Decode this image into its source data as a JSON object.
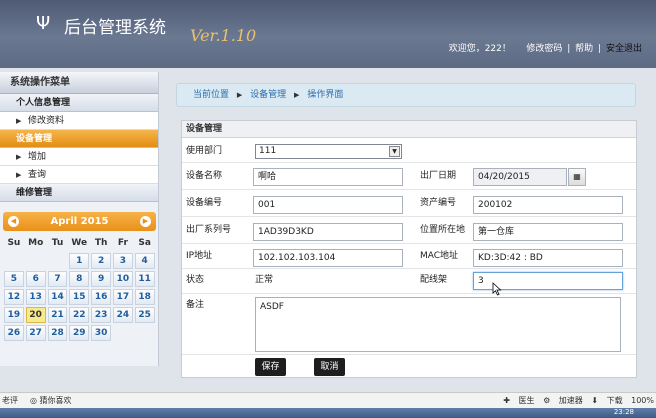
{
  "header": {
    "logo_glyph": "Ψ",
    "title": "后台管理系统",
    "version": "Ver.1.10",
    "welcome": "欢迎您，222！",
    "change_password": "修改密码",
    "help": "帮助",
    "logout": "安全退出"
  },
  "sidebar": {
    "title": "系统操作菜单",
    "groups": [
      {
        "label": "个人信息管理",
        "items": [
          "修改资料"
        ]
      },
      {
        "label": "设备管理",
        "items": [
          "增加",
          "查询"
        ]
      },
      {
        "label": "维修管理",
        "items": []
      }
    ]
  },
  "calendar": {
    "month_label": "April 2015",
    "weekdays": [
      "Su",
      "Mo",
      "Tu",
      "We",
      "Th",
      "Fr",
      "Sa"
    ],
    "today": "20",
    "weeks": [
      [
        "",
        "",
        "",
        "1",
        "2",
        "3",
        "4"
      ],
      [
        "5",
        "6",
        "7",
        "8",
        "9",
        "10",
        "11"
      ],
      [
        "12",
        "13",
        "14",
        "15",
        "16",
        "17",
        "18"
      ],
      [
        "19",
        "20",
        "21",
        "22",
        "23",
        "24",
        "25"
      ],
      [
        "26",
        "27",
        "28",
        "29",
        "30",
        "",
        ""
      ]
    ]
  },
  "breadcrumb": {
    "items": [
      "当前位置",
      "设备管理",
      "操作界面"
    ]
  },
  "form": {
    "title": "设备管理",
    "department_label": "使用部门",
    "department_value": "111",
    "name_label": "设备名称",
    "name_value": "啊哈",
    "factory_date_label": "出厂日期",
    "factory_date_value": "04/20/2015",
    "device_no_label": "设备编号",
    "device_no_value": "001",
    "asset_no_label": "资产编号",
    "asset_no_value": "200102",
    "serial_label": "出厂系列号",
    "serial_value": "1AD39D3KD",
    "location_label": "位置所在地",
    "location_value": "第一仓库",
    "ip_label": "IP地址",
    "ip_value": "102.102.103.104",
    "mac_label": "MAC地址",
    "mac_value": "KD:3D:42 : BD",
    "status_label": "状态",
    "status_value": "正常",
    "rack_label": "配线架",
    "rack_value": "3",
    "remark_label": "备注",
    "remark_value": "ASDF",
    "save_label": "保存",
    "cancel_label": "取消"
  },
  "statusbar": {
    "left1": "老评",
    "left2": "猜你喜欢",
    "right_items": [
      "医生",
      "加速器",
      "下载"
    ],
    "zoom": "100%"
  },
  "taskbar": {
    "clock": "23:28"
  },
  "colors": {
    "header_bg": "#5d6a83",
    "accent_orange": "#e8911a",
    "link_blue": "#2b6fb0"
  }
}
